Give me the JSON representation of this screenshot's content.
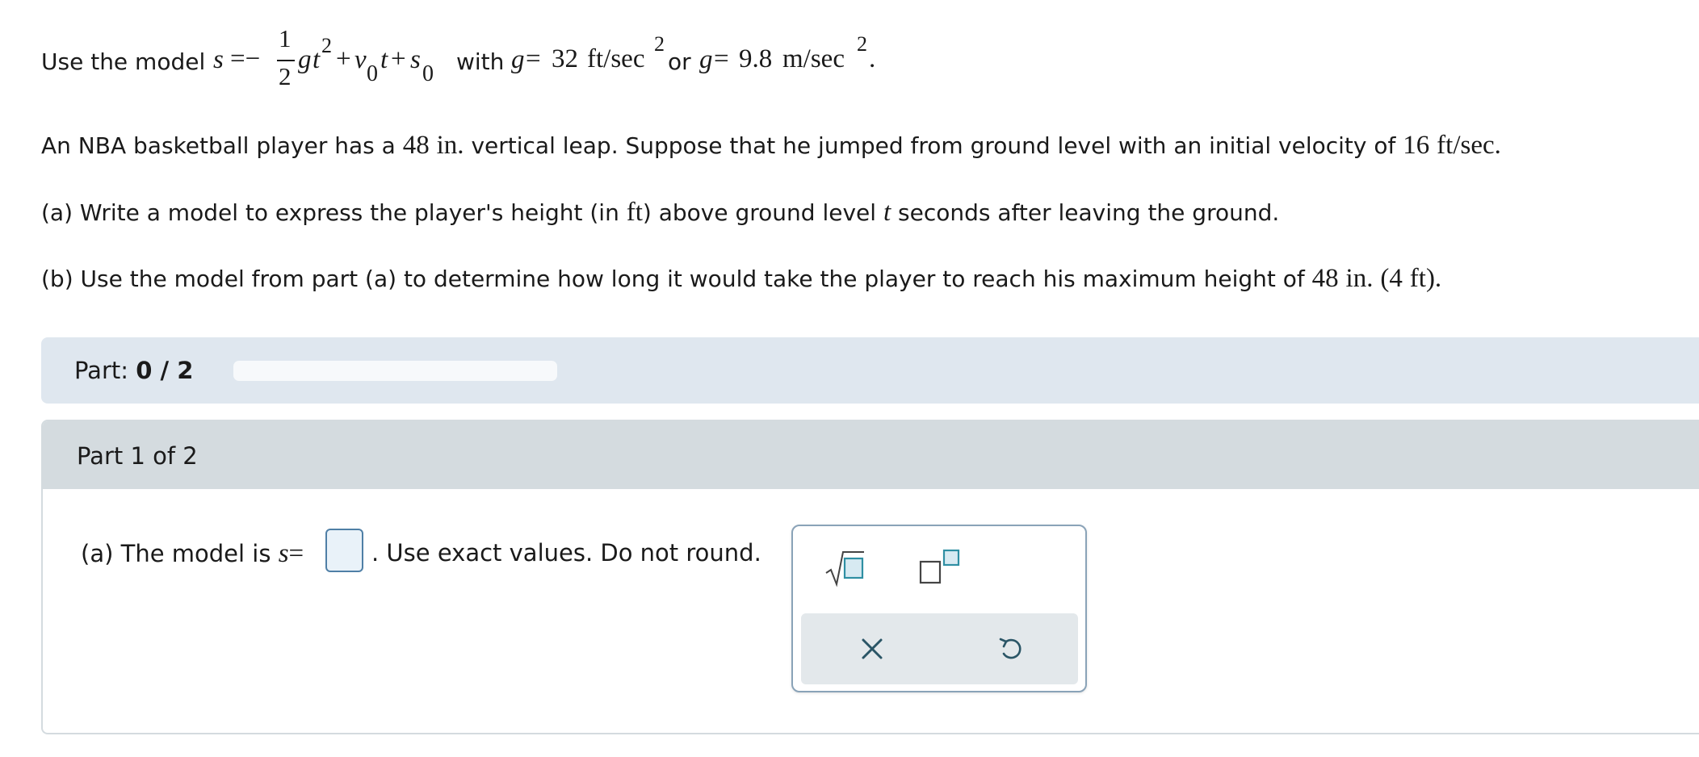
{
  "intro": {
    "prefix": "Use the model",
    "with_word": "with",
    "or_word": "or",
    "g_eq": "g=",
    "g_val_ft": "32",
    "g_unit_ft": "ft/sec",
    "g_val_m": "9.8",
    "g_unit_m": "m/sec",
    "period": "."
  },
  "problem": {
    "text_1": "An NBA basketball player has a",
    "leap": "48",
    "leap_unit": "in.",
    "text_2": "vertical leap. Suppose that he jumped from ground level with an initial velocity of",
    "velocity": "16",
    "velocity_unit": "ft/sec."
  },
  "question_a": {
    "text_1": "(a) Write a model to express the player's height (in",
    "unit": "ft",
    "text_2": ") above ground level",
    "var": "t",
    "text_3": "seconds after leaving the ground."
  },
  "question_b": {
    "text_1": "(b) Use the model from part (a) to determine how long it would take the player to reach his maximum height of",
    "height": "48",
    "height_unit": "in.",
    "paren_val": "(4",
    "paren_unit": "ft)."
  },
  "progress": {
    "label": "Part:",
    "value": "0 / 2",
    "fraction": 0
  },
  "part": {
    "title": "Part 1 of 2",
    "answer_prefix": "(a) The model is",
    "answer_var": "s",
    "answer_eq": "=",
    "answer_hint": ". Use exact values. Do not round."
  },
  "palette": {
    "buttons": [
      "sqrt-icon",
      "exponent-icon",
      "clear-icon",
      "undo-icon"
    ]
  },
  "colors": {
    "progress_bg": "#dfe7ef",
    "part_header_bg": "#d4dbdf",
    "input_bg": "#e9f2f9",
    "icon_teal": "#2f8fa3"
  }
}
